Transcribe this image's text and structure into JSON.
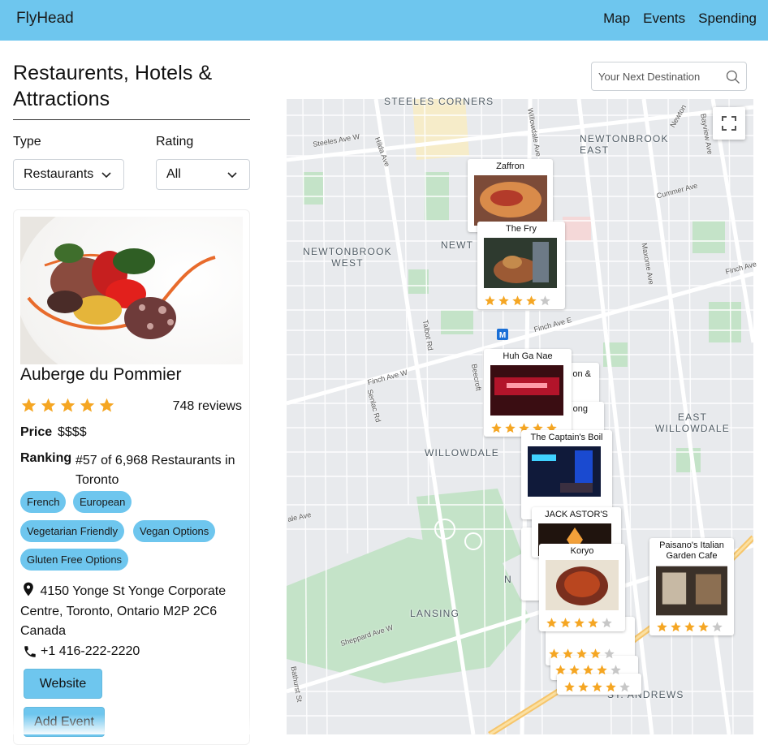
{
  "app": {
    "brand": "FlyHead",
    "nav": [
      "Map",
      "Events",
      "Spending"
    ]
  },
  "sidebar": {
    "title": "Restaurents, Hotels & Attractions",
    "type_label": "Type",
    "type_value": "Restaurants",
    "rating_label": "Rating",
    "rating_value": "All"
  },
  "search": {
    "placeholder": "Your Next Destination"
  },
  "place": {
    "name": "Auberge du Pommier",
    "rating": 5,
    "reviews": "748 reviews",
    "price_label": "Price",
    "price_value": "$$$$",
    "ranking_label": "Ranking",
    "ranking_value": "#57 of 6,968 Restaurants in Toronto",
    "tags": [
      "French",
      "European",
      "Vegetarian Friendly",
      "Vegan Options",
      "Gluten Free Options"
    ],
    "address": "4150 Yonge St Yonge Corporate Centre, Toronto, Ontario M2P 2C6 Canada",
    "phone": "+1 416-222-2220",
    "website_label": "Website",
    "add_event_label": "Add Event"
  },
  "map": {
    "areas": [
      "STEELES CORNERS",
      "NEWTONBROOK EAST",
      "NEWTONBROOK WEST",
      "EAST WILLOWDALE",
      "WILLOWDALE",
      "LANSING",
      "ST. ANDREWS",
      "NEWT",
      "N"
    ],
    "streets": [
      "Steeles Ave W",
      "Hilda Ave",
      "Willowdale Ave",
      "Newton",
      "Bayview Ave",
      "Cummer Ave",
      "Maxome Ave",
      "Finch Ave",
      "Talbot Rd",
      "Finch Ave E",
      "Finch Ave W",
      "Beecroft",
      "Senlac Rd",
      "Sheppard Ave W",
      "Bathurst St",
      "ale Ave"
    ],
    "markers": [
      {
        "name": "Zaffron",
        "rating": 0
      },
      {
        "name": "The Fry",
        "rating": 4
      },
      {
        "name": "Huh Ga Nae",
        "rating": 5
      },
      {
        "name": "on &",
        "rating": 0
      },
      {
        "name": "ong",
        "rating": 0
      },
      {
        "name": "The Captain's Boil",
        "rating": 0
      },
      {
        "name": "JACK ASTOR'S",
        "rating": 0
      },
      {
        "name": "Koryo",
        "rating": 4
      },
      {
        "name": "Paisano's Italian Garden Cafe",
        "rating": 4
      }
    ],
    "extra_star_rows": [
      4,
      4,
      4
    ],
    "road_badge": "M"
  },
  "colors": {
    "accent": "#6ec6ee",
    "star": "#f5a623",
    "star_empty": "#c7c7c7",
    "map_bg": "#e8eaed",
    "park": "#c4e3c8"
  }
}
